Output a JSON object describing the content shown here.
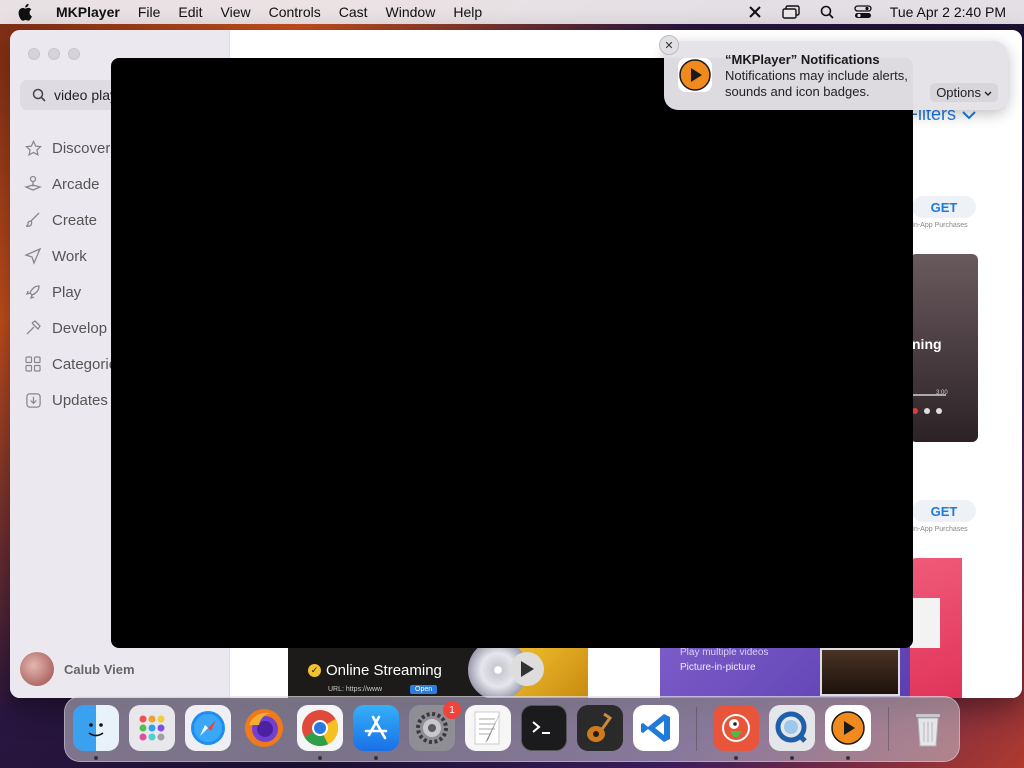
{
  "menubar": {
    "app_name": "MKPlayer",
    "items": [
      "File",
      "Edit",
      "View",
      "Controls",
      "Cast",
      "Window",
      "Help"
    ],
    "clock": "Tue Apr 2  2:40 PM",
    "status_icons": [
      "scissors-icon",
      "screen-mirror-icon",
      "search-icon",
      "control-center-icon"
    ]
  },
  "appstore": {
    "search_value": "video play",
    "nav": [
      {
        "label": "Discover",
        "icon": "star-icon"
      },
      {
        "label": "Arcade",
        "icon": "joystick-icon"
      },
      {
        "label": "Create",
        "icon": "brush-icon"
      },
      {
        "label": "Work",
        "icon": "paperplane-icon"
      },
      {
        "label": "Play",
        "icon": "rocket-icon"
      },
      {
        "label": "Develop",
        "icon": "hammer-icon"
      },
      {
        "label": "Categories",
        "icon": "grid-icon"
      },
      {
        "label": "Updates",
        "icon": "download-icon"
      }
    ],
    "user_name": "Calub Viem",
    "filters_label": "Filters",
    "get_label": "GET",
    "iap_label": "In-App Purchases",
    "promo_text": "ning",
    "promo_time": "3:00",
    "stream_card": {
      "title": "Online Streaming",
      "url": "URL: https://www",
      "open": "Open"
    },
    "pip_card": {
      "line1": "Play multiple videos",
      "line2": "Picture-in-picture"
    }
  },
  "notification": {
    "title": "“MKPlayer” Notifications",
    "body": "Notifications may include alerts, sounds and icon badges.",
    "options_label": "Options",
    "accent": "#f08a1c"
  },
  "dock": {
    "apps": [
      "Finder",
      "Launchpad",
      "Safari",
      "Firefox",
      "Chrome",
      "App Store",
      "System Settings",
      "TextEdit",
      "Terminal",
      "GarageBand",
      "Visual Studio Code",
      "DuckDuckGo",
      "QuickTime Player",
      "MKPlayer",
      "Trash"
    ],
    "settings_badge": "1"
  }
}
